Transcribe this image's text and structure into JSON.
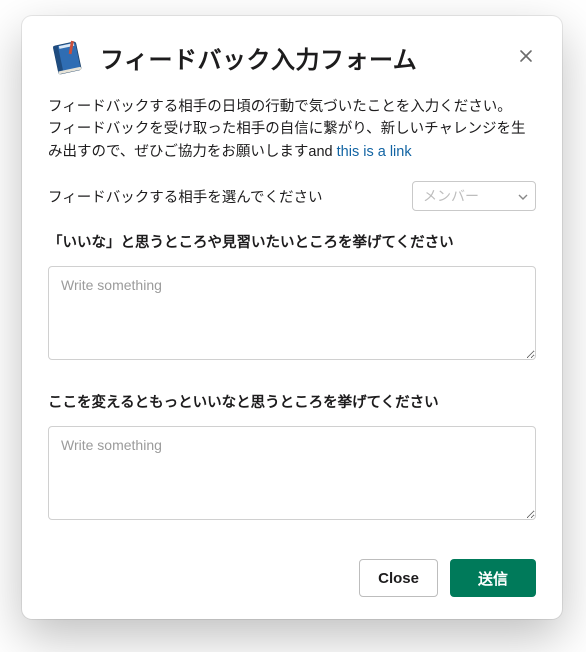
{
  "header": {
    "title": "フィードバック入力フォーム"
  },
  "intro": {
    "line1": "フィードバックする相手の日頃の行動で気づいたことを入力ください。",
    "line2_a": "フィードバックを受け取った相手の自信に繋がり、新しいチャレンジを生み出すので、ぜひご協力をお願いしますand ",
    "link_text": "this is a link"
  },
  "select": {
    "label": "フィードバックする相手を選んでください",
    "placeholder": "メンバー"
  },
  "section1": {
    "label": "「いいな」と思うところや見習いたいところを挙げてください",
    "placeholder": "Write something"
  },
  "section2": {
    "label": "ここを変えるともっといいなと思うところを挙げてください",
    "placeholder": "Write something"
  },
  "footer": {
    "close_label": "Close",
    "submit_label": "送信"
  }
}
